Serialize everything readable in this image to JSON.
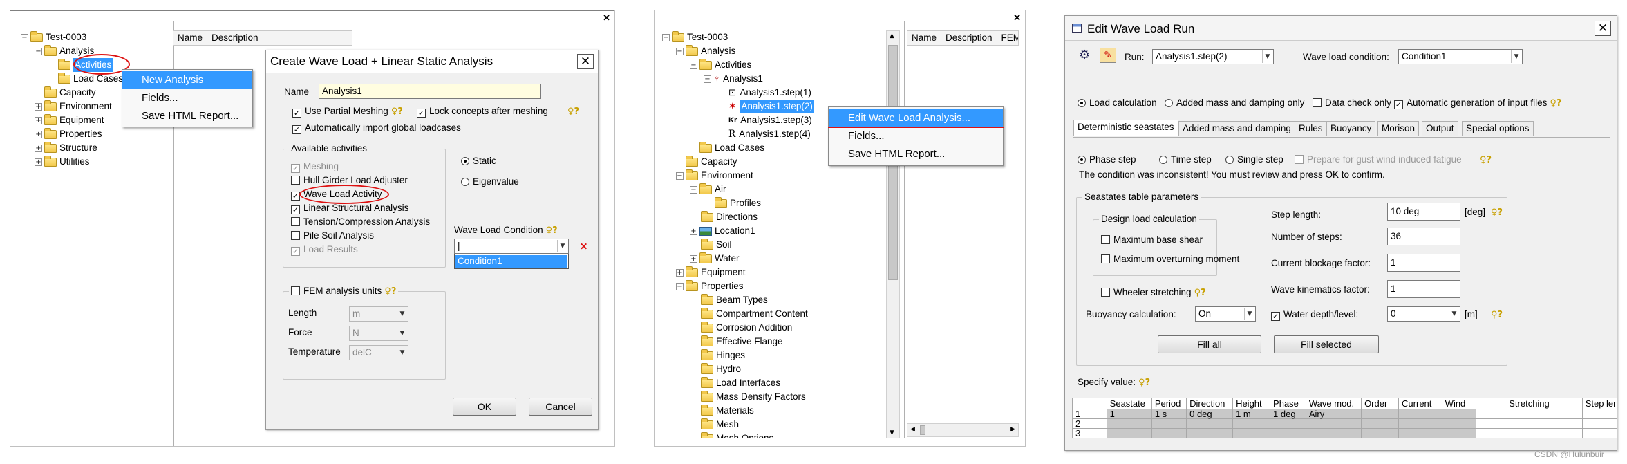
{
  "panel1": {
    "tree": [
      "Test-0003",
      "Analysis",
      "Activities",
      "Load Cases",
      "Capacity",
      "Environment",
      "Equipment",
      "Properties",
      "Structure",
      "Utilities"
    ],
    "columns": [
      "Name",
      "Description"
    ],
    "context_menu": [
      "New Analysis",
      "Fields...",
      "Save HTML Report..."
    ],
    "dialog": {
      "title": "Create Wave Load + Linear Static Analysis",
      "name_label": "Name",
      "name_value": "Analysis1",
      "use_partial_meshing": "Use Partial Meshing",
      "lock_concepts": "Lock concepts after meshing",
      "auto_import": "Automatically import global loadcases",
      "available_activities_label": "Available activities",
      "activities": [
        "Meshing",
        "Hull Girder Load Adjuster",
        "Wave Load Activity",
        "Linear Structural Analysis",
        "Tension/Compression Analysis",
        "Pile Soil Analysis",
        "Load Results"
      ],
      "static_label": "Static",
      "eigenvalue_label": "Eigenvalue",
      "wave_load_condition_label": "Wave Load Condition",
      "wave_load_condition_option": "Condition1",
      "fem_units_label": "FEM analysis units",
      "length_label": "Length",
      "length_value": "m",
      "force_label": "Force",
      "force_value": "N",
      "temperature_label": "Temperature",
      "temperature_value": "delC",
      "ok_label": "OK",
      "cancel_label": "Cancel"
    }
  },
  "panel2": {
    "tree": [
      "Test-0003",
      "Analysis",
      "Activities",
      "Analysis1",
      "Analysis1.step(1)",
      "Analysis1.step(2)",
      "Analysis1.step(3)",
      "Analysis1.step(4)",
      "Load Cases",
      "Capacity",
      "Environment",
      "Air",
      "Profiles",
      "Directions",
      "Location1",
      "Soil",
      "Water",
      "Equipment",
      "Properties",
      "Beam Types",
      "Compartment Content",
      "Corrosion Addition",
      "Effective Flange",
      "Hinges",
      "Hydro",
      "Load Interfaces",
      "Mass Density Factors",
      "Materials",
      "Mesh",
      "Mesh Options"
    ],
    "columns": [
      "Name",
      "Description",
      "FEM"
    ],
    "context_menu": [
      "Edit Wave Load Analysis...",
      "Fields...",
      "Save HTML Report..."
    ]
  },
  "panel3": {
    "title": "Edit Wave Load Run",
    "run_label": "Run:",
    "run_value": "Analysis1.step(2)",
    "wave_load_condition_label": "Wave load condition:",
    "wave_load_condition_value": "Condition1",
    "load_calculation": "Load calculation",
    "added_mass_only": "Added mass and damping only",
    "data_check_only": "Data check only",
    "auto_input_files": "Automatic generation of input files",
    "tabs": [
      "Deterministic seastates",
      "Added mass and damping",
      "Rules",
      "Buoyancy",
      "Morison",
      "Output",
      "Special options"
    ],
    "phase_step": "Phase step",
    "time_step": "Time step",
    "single_step": "Single step",
    "prepare_fatigue": "Prepare for gust wind induced fatigue",
    "warning": "The condition was inconsistent! You must review and press OK to confirm.",
    "seastates_params": "Seastates table parameters",
    "design_load_calc": "Design load calculation",
    "max_base_shear": "Maximum base shear",
    "max_overturning": "Maximum overturning moment",
    "wheeler": "Wheeler stretching",
    "buoyancy_calc": "Buoyancy calculation:",
    "buoyancy_value": "On",
    "step_length_label": "Step length:",
    "step_length_value": "10 deg",
    "step_length_unit": "[deg]",
    "num_steps_label": "Number of steps:",
    "num_steps_value": "36",
    "current_blockage_label": "Current blockage factor:",
    "current_blockage_value": "1",
    "wave_kin_label": "Wave kinematics factor:",
    "wave_kin_value": "1",
    "water_depth_label": "Water depth/level:",
    "water_depth_value": "0",
    "water_depth_unit": "[m]",
    "fill_all": "Fill all",
    "fill_selected": "Fill selected",
    "specify_value": "Specify value:",
    "table": {
      "headers": [
        "",
        "Seastate",
        "Period",
        "Direction",
        "Height",
        "Phase",
        "Wave mod.",
        "Order",
        "Current",
        "Wind",
        "Stretching",
        "Step len"
      ],
      "rows": [
        [
          "1",
          "1",
          "1 s",
          "0 deg",
          "1 m",
          "1 deg",
          "Airy",
          "",
          "",
          "",
          "",
          ""
        ],
        [
          "2",
          "",
          "",
          "",
          "",
          "",
          "",
          "",
          "",
          "",
          "",
          ""
        ],
        [
          "3",
          "",
          "",
          "",
          "",
          "",
          "",
          "",
          "",
          "",
          "",
          ""
        ]
      ]
    }
  },
  "watermark": "CSDN @Hulunbuir",
  "colors": {
    "selection": "#3399ff",
    "highlight_circle": "#d11111",
    "dialog_bg": "#f0f0f0"
  }
}
